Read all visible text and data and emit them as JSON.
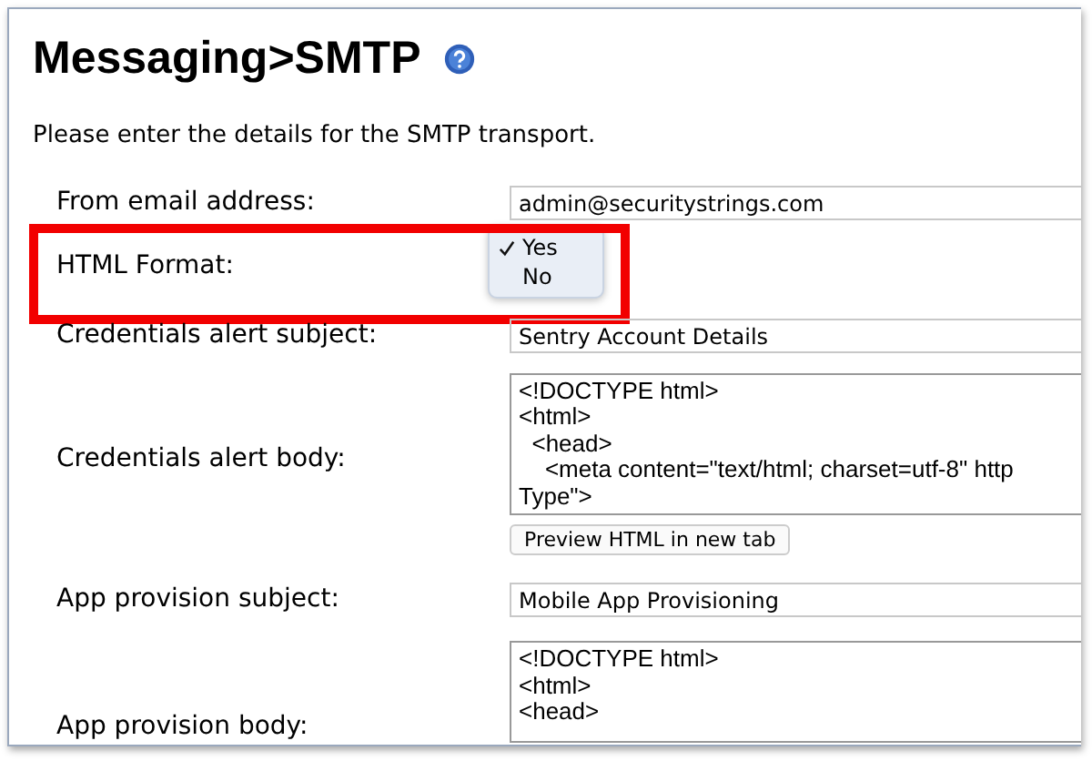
{
  "title": "Messaging>SMTP",
  "intro": "Please enter the details for the SMTP transport.",
  "fields": [
    {
      "kind": "text",
      "label": "From email address:",
      "value": "admin@securitystrings.com",
      "highlighted": false
    },
    {
      "kind": "select",
      "label": "HTML Format:",
      "highlighted": true,
      "options": [
        {
          "label": "Yes",
          "selected": true
        },
        {
          "label": "No",
          "selected": false
        }
      ]
    },
    {
      "kind": "text",
      "label": "Credentials alert subject:",
      "value": "Sentry Account Details",
      "highlighted": false
    },
    {
      "kind": "textarea",
      "label": "Credentials alert body:",
      "lines": [
        "<!DOCTYPE html>",
        "<html>",
        "  <head>",
        "    <meta content=\"text/html; charset=utf-8\" http",
        "Type\">"
      ],
      "button": "Preview HTML in new tab",
      "highlighted": false
    },
    {
      "kind": "text",
      "label": "App provision subject:",
      "value": "Mobile App Provisioning",
      "highlighted": false
    },
    {
      "kind": "textarea",
      "label": "App provision body:",
      "lines": [
        "<!DOCTYPE html>",
        "<html>",
        "<head>"
      ],
      "highlighted": false
    }
  ]
}
